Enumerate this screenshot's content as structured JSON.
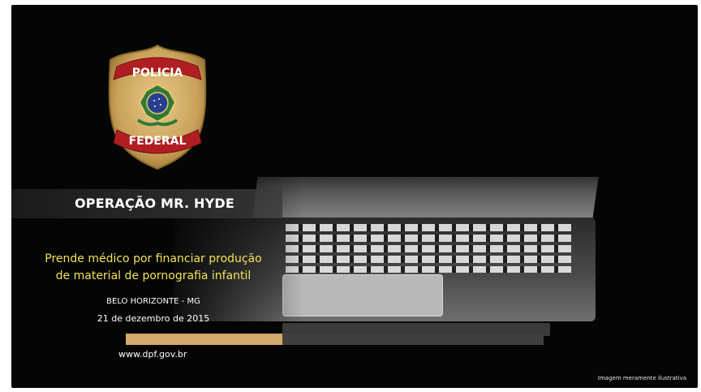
{
  "slide": {
    "operation_title": "OPERAÇÃO MR. HYDE",
    "headline_line1": "Prende médico por financiar produção",
    "headline_line2": "de material de pornografia infantil",
    "location": "BELO HORIZONTE - MG",
    "date": "21 de dezembro de 2015",
    "website": "www.dpf.gov.br",
    "disclaimer": "Imagem meramente ilustrativa"
  },
  "badge": {
    "top_banner": "POLICIA",
    "bottom_banner": "FEDERAL",
    "icon": "policia-federal-badge-icon"
  },
  "colors": {
    "background": "#050505",
    "headline": "#f2e25a",
    "accent_bar": "#d2a96a",
    "badge_gold": "#c9a25a",
    "banner_red": "#b11e22"
  }
}
